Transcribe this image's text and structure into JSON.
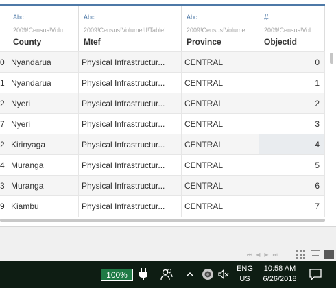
{
  "grid": {
    "columns": [
      {
        "key": "county",
        "type_icon": "Abc",
        "source": "2009!Census!Volu...",
        "name": "County"
      },
      {
        "key": "mtef",
        "type_icon": "Abc",
        "source": "2009!Census!Volume!II!Table!...",
        "name": "Mtef"
      },
      {
        "key": "province",
        "type_icon": "Abc",
        "source": "2009!Census!Volume...",
        "name": "Province"
      },
      {
        "key": "objectid",
        "type_icon": "#",
        "source": "2009!Census!Vol...",
        "name": "Objectid"
      }
    ],
    "rows": [
      {
        "rowid": "0",
        "county": "Nyandarua",
        "mtef": "Physical Infrastructur...",
        "province": "CENTRAL",
        "objectid": "0"
      },
      {
        "rowid": "1",
        "county": "Nyandarua",
        "mtef": "Physical Infrastructur...",
        "province": "CENTRAL",
        "objectid": "1"
      },
      {
        "rowid": "2",
        "county": "Nyeri",
        "mtef": "Physical Infrastructur...",
        "province": "CENTRAL",
        "objectid": "2"
      },
      {
        "rowid": "7",
        "county": "Nyeri",
        "mtef": "Physical Infrastructur...",
        "province": "CENTRAL",
        "objectid": "3"
      },
      {
        "rowid": "2",
        "county": "Kirinyaga",
        "mtef": "Physical Infrastructur...",
        "province": "CENTRAL",
        "objectid": "4"
      },
      {
        "rowid": "4",
        "county": "Muranga",
        "mtef": "Physical Infrastructur...",
        "province": "CENTRAL",
        "objectid": "5"
      },
      {
        "rowid": "3",
        "county": "Muranga",
        "mtef": "Physical Infrastructur...",
        "province": "CENTRAL",
        "objectid": "6"
      },
      {
        "rowid": "9",
        "county": "Kiambu",
        "mtef": "Physical Infrastructur...",
        "province": "CENTRAL",
        "objectid": "7"
      }
    ]
  },
  "taskbar": {
    "zoom": "100%",
    "lang_line1": "ENG",
    "lang_line2": "US",
    "time": "10:58 AM",
    "date": "6/26/2018"
  },
  "icons": {
    "plug": "power-plug-icon",
    "people": "people-icon",
    "chevron": "chevron-up-icon",
    "camera": "camera-icon",
    "mute": "speaker-muted-icon",
    "notification": "notification-icon"
  },
  "colors": {
    "accent": "#4e79a7",
    "taskbar_bg": "#0e1d13",
    "zoom_badge_bg": "#1f7a45"
  }
}
